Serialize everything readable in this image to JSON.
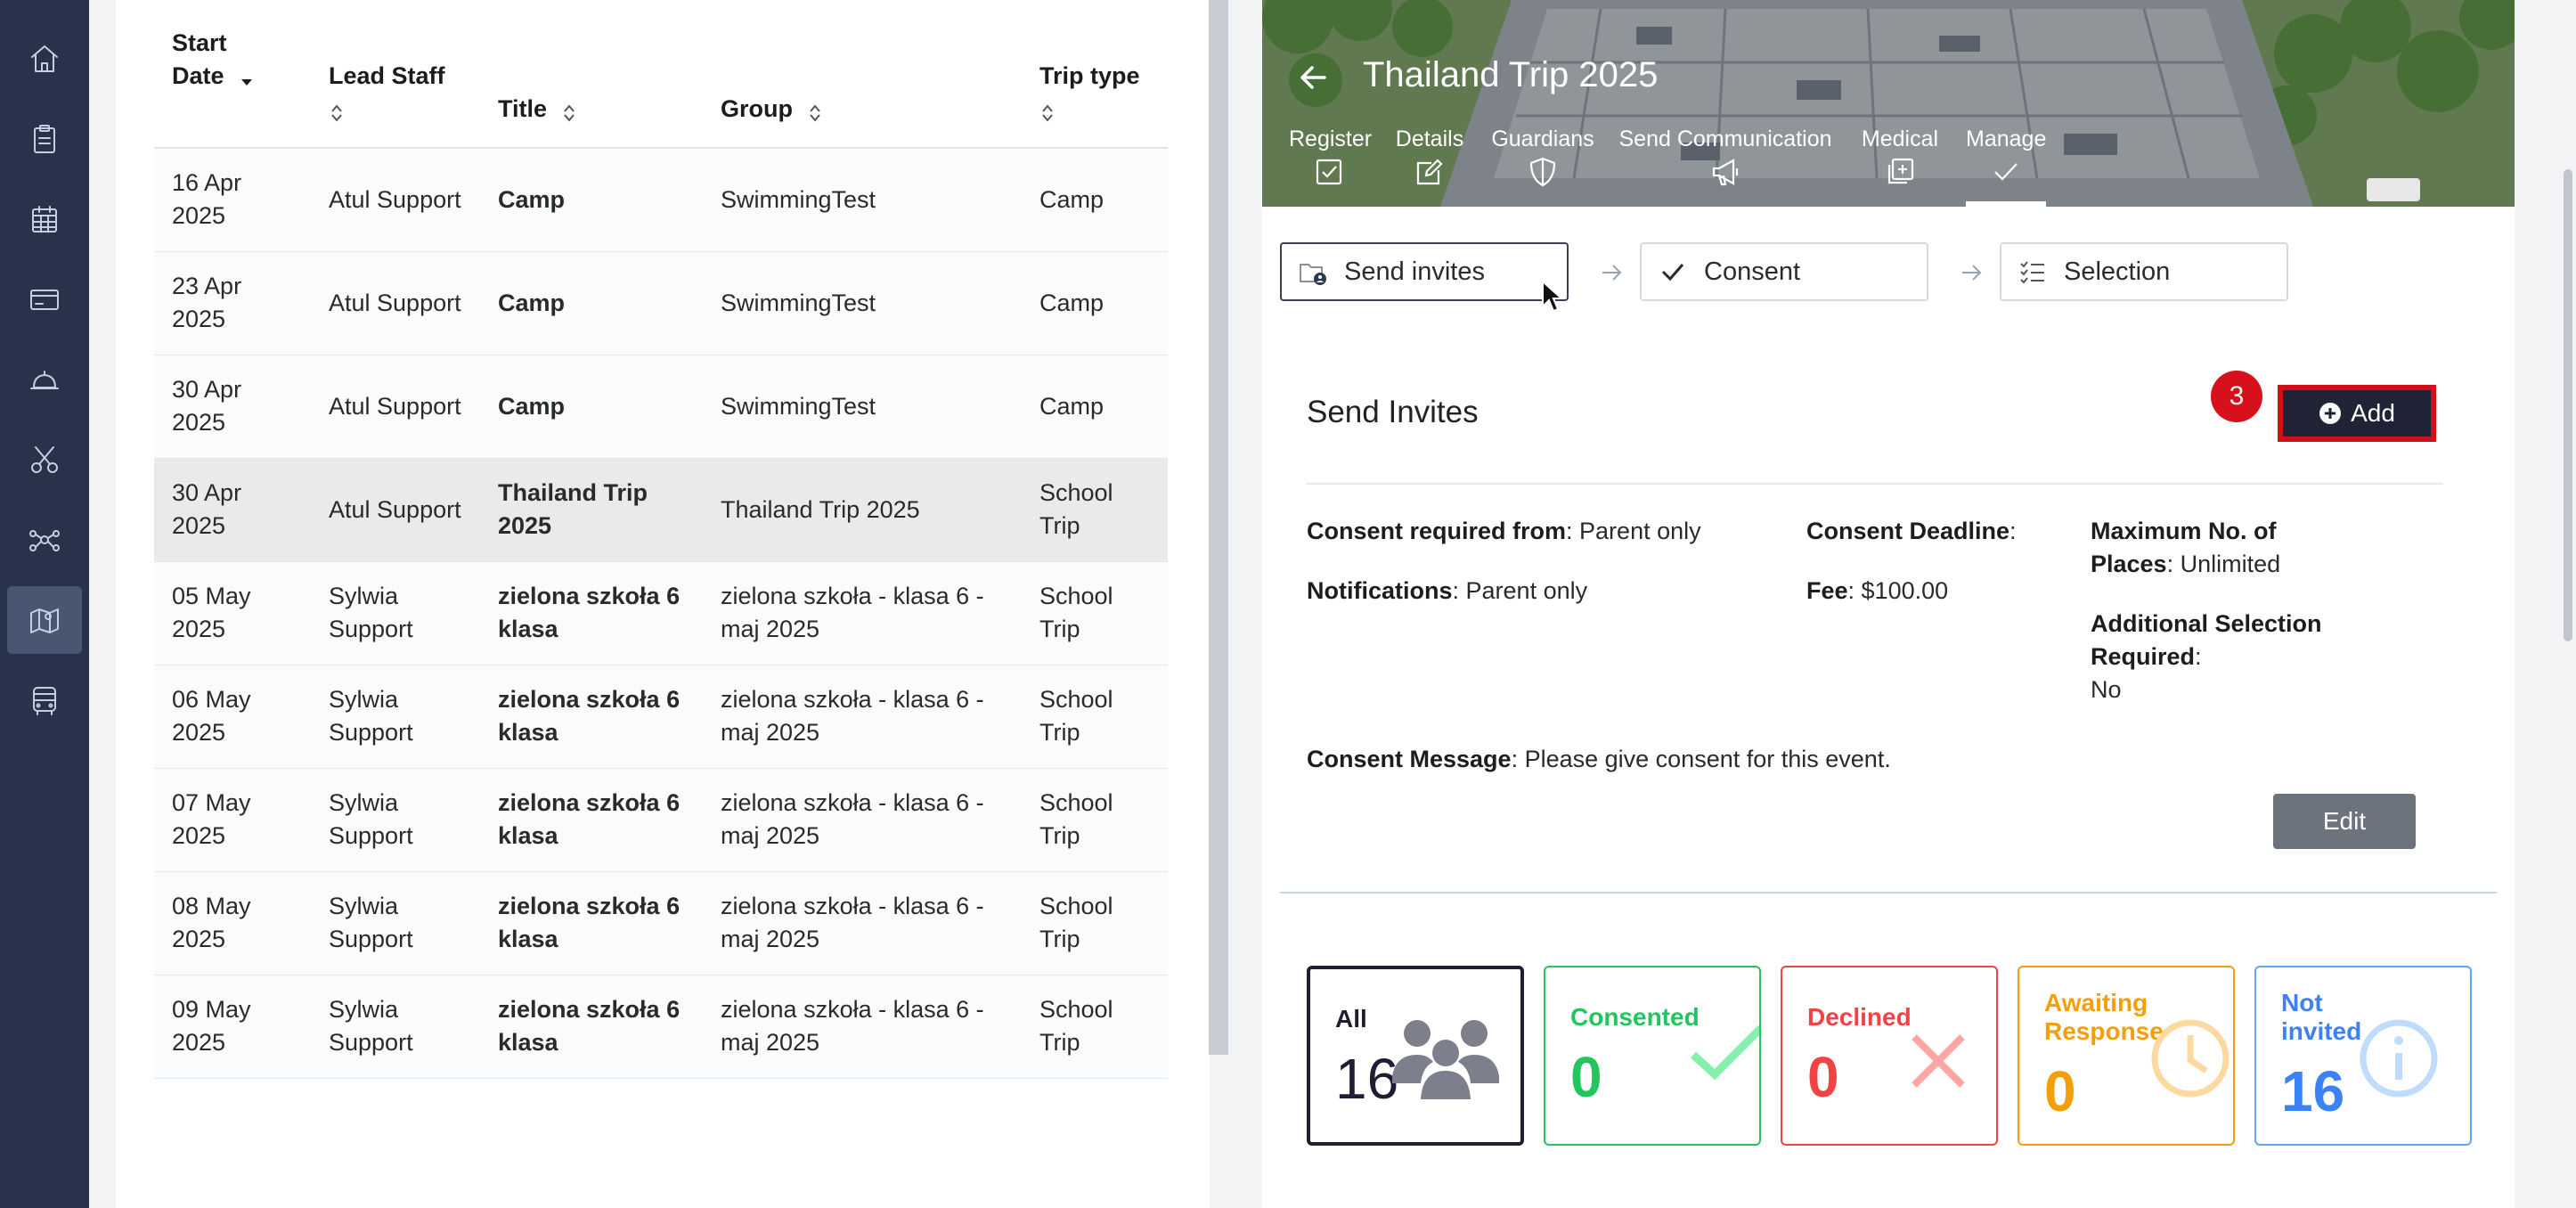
{
  "sidebar": {
    "items": [
      {
        "icon": "home-icon"
      },
      {
        "icon": "clipboard-icon"
      },
      {
        "icon": "calendar-icon"
      },
      {
        "icon": "card-icon"
      },
      {
        "icon": "bell-icon"
      },
      {
        "icon": "scissors-icon"
      },
      {
        "icon": "network-icon"
      },
      {
        "icon": "map-icon",
        "active": true
      },
      {
        "icon": "bus-icon"
      }
    ]
  },
  "trips_table": {
    "columns": [
      "Start Date",
      "Lead Staff",
      "Title",
      "Group",
      "Trip type"
    ],
    "rows": [
      [
        "16 Apr 2025",
        "Atul Support",
        "Camp",
        "SwimmingTest",
        "Camp"
      ],
      [
        "23 Apr 2025",
        "Atul Support",
        "Camp",
        "SwimmingTest",
        "Camp"
      ],
      [
        "30 Apr 2025",
        "Atul Support",
        "Camp",
        "SwimmingTest",
        "Camp"
      ],
      [
        "30 Apr 2025",
        "Atul Support",
        "Thailand Trip 2025",
        "Thailand Trip 2025",
        "School Trip"
      ],
      [
        "05 May 2025",
        "Sylwia Support",
        "zielona szkoła 6 klasa",
        "zielona szkoła - klasa 6 - maj 2025",
        "School Trip"
      ],
      [
        "06 May 2025",
        "Sylwia Support",
        "zielona szkoła 6 klasa",
        "zielona szkoła - klasa 6 - maj 2025",
        "School Trip"
      ],
      [
        "07 May 2025",
        "Sylwia Support",
        "zielona szkoła 6 klasa",
        "zielona szkoła - klasa 6 - maj 2025",
        "School Trip"
      ],
      [
        "08 May 2025",
        "Sylwia Support",
        "zielona szkoła 6 klasa",
        "zielona szkoła - klasa 6 - maj 2025",
        "School Trip"
      ],
      [
        "09 May 2025",
        "Sylwia Support",
        "zielona szkoła 6 klasa",
        "zielona szkoła - klasa 6 - maj 2025",
        "School Trip"
      ]
    ],
    "selected_row": 3
  },
  "detail": {
    "title": "Thailand Trip 2025",
    "tabs": [
      "Register",
      "Details",
      "Guardians",
      "Send Communication",
      "Medical",
      "Manage"
    ],
    "active_tab": "Manage",
    "steps": [
      "Send invites",
      "Consent",
      "Selection"
    ],
    "section_title": "Send Invites",
    "badge": "3",
    "add_label": "Add",
    "consent_required_label": "Consent required from",
    "consent_required_value": ": Parent only",
    "notifications_label": "Notifications",
    "notifications_value": ": Parent only",
    "consent_deadline_label": "Consent Deadline",
    "consent_deadline_value": ":",
    "fee_label": "Fee",
    "fee_value": ": $100.00",
    "max_places_label": "Maximum No. of Places",
    "max_places_value": ": Unlimited",
    "additional_label": "Additional Selection Required",
    "additional_value": ":",
    "additional_answer": "No",
    "consent_message_label": "Consent Message",
    "consent_message_value": ": Please give consent for this event.",
    "edit_label": "Edit"
  },
  "stats": [
    {
      "label": "All",
      "value": "16",
      "color": "#1f1d33"
    },
    {
      "label": "Consented",
      "value": "0",
      "color": "#22c55e"
    },
    {
      "label": "Declined",
      "value": "0",
      "color": "#ef4444"
    },
    {
      "label": "Awaiting Response",
      "value": "0",
      "color": "#f59e0b"
    },
    {
      "label": "Not invited",
      "value": "16",
      "color": "#3b82f6"
    }
  ]
}
